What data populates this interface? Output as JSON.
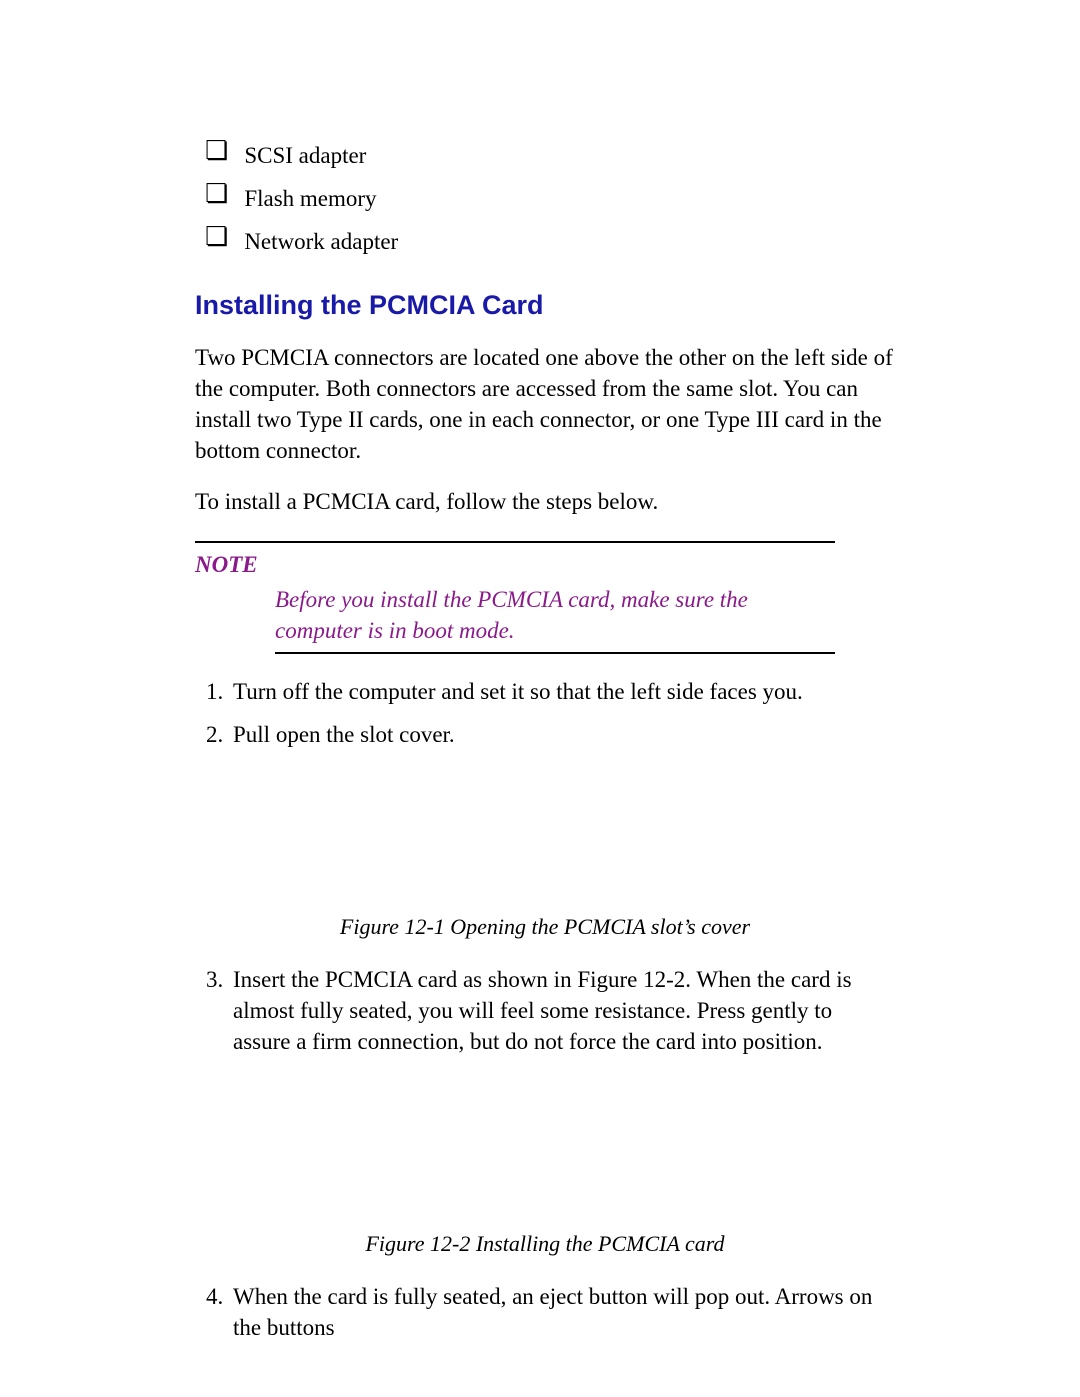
{
  "checklist": [
    "SCSI adapter",
    "Flash memory",
    "Network adapter"
  ],
  "heading": "Installing the PCMCIA Card",
  "intro_p1": "Two PCMCIA connectors are located one above the other on the left side of the computer. Both connectors are accessed from the same slot. You can install two Type II cards, one in each connector, or one Type III card in the bottom connector.",
  "intro_p2": "To install a PCMCIA card, follow the steps below.",
  "note": {
    "label": "NOTE",
    "body": "Before you install the PCMCIA card, make sure the computer is in boot mode."
  },
  "steps": {
    "s1": "Turn off the computer and set it so that the left side faces you.",
    "s2": "Pull open the slot cover.",
    "s3": "Insert the PCMCIA card as shown in Figure 12-2. When the card is almost fully seated, you will feel some resistance. Press gently to assure a firm connection, but do not force the card into position.",
    "s4": "When the card is fully seated, an eject button will pop out. Arrows on the buttons"
  },
  "figures": {
    "f1": "Figure 12-1  Opening the PCMCIA slot’s cover",
    "f2": "Figure 12-2 Installing the PCMCIA card"
  }
}
